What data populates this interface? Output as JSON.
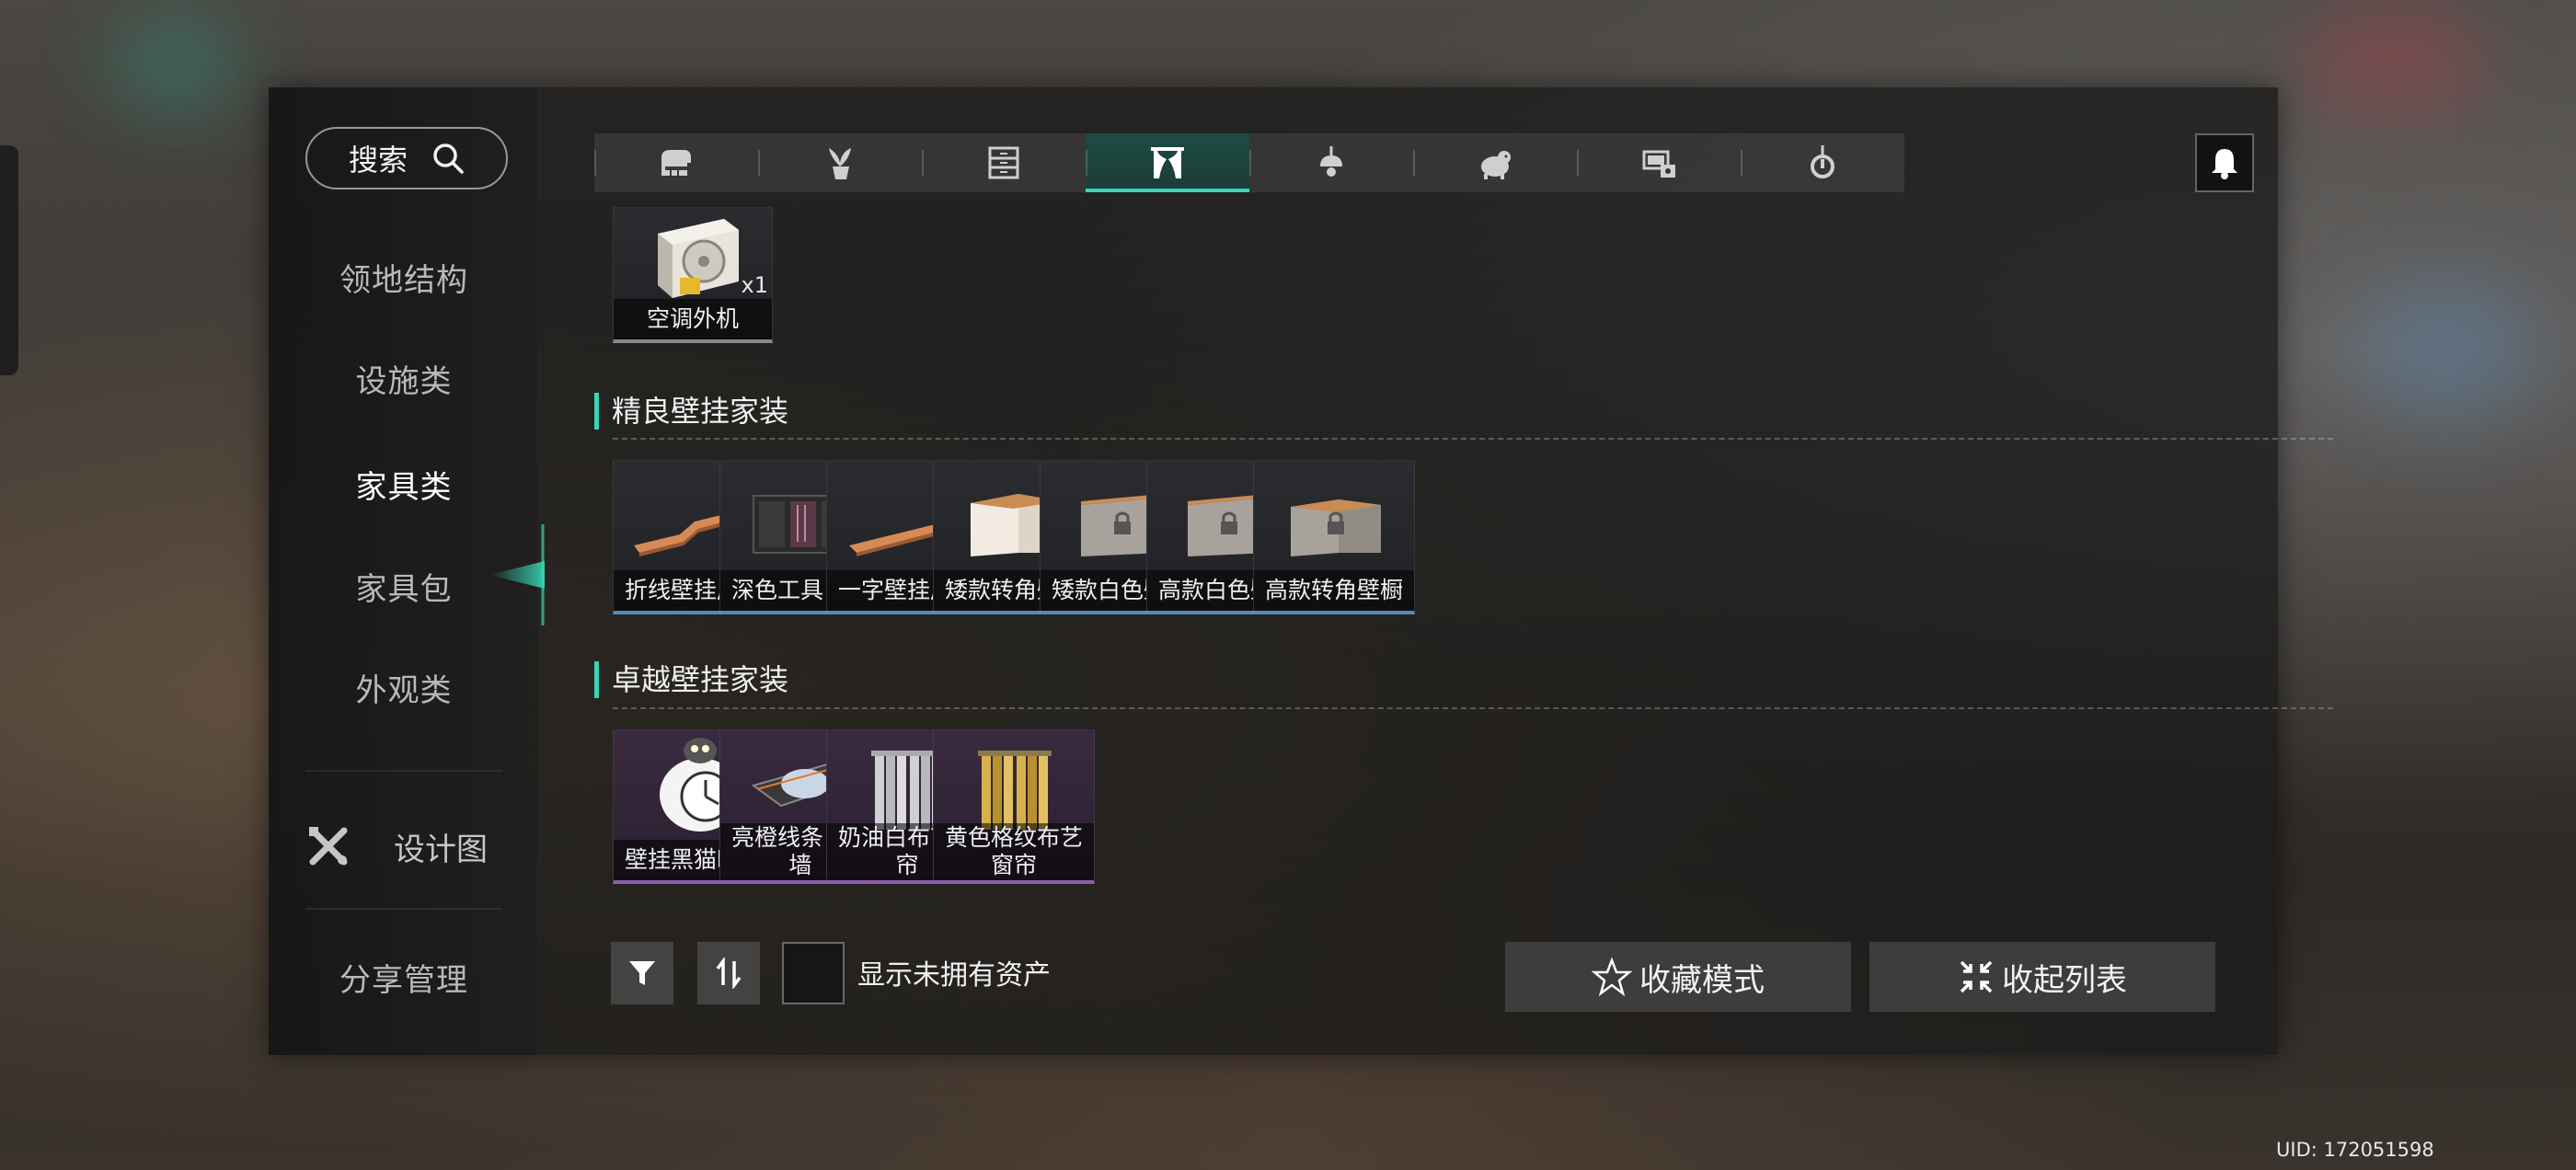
{
  "search": {
    "label": "搜索",
    "icon": "search-icon"
  },
  "sidebar": {
    "items": [
      {
        "label": "领地结构",
        "active": false
      },
      {
        "label": "设施类",
        "active": false
      },
      {
        "label": "家具类",
        "active": true
      },
      {
        "label": "家具包",
        "active": false
      },
      {
        "label": "外观类",
        "active": false
      }
    ],
    "design": {
      "label": "设计图",
      "icon": "design-tools-icon"
    },
    "share": {
      "label": "分享管理"
    }
  },
  "tabs": [
    {
      "icon": "piano-icon",
      "active": false
    },
    {
      "icon": "potted-plant-icon",
      "active": false
    },
    {
      "icon": "drawer-cabinet-icon",
      "active": false
    },
    {
      "icon": "curtain-icon",
      "active": true
    },
    {
      "icon": "ceiling-lamp-icon",
      "active": false
    },
    {
      "icon": "pet-icon",
      "active": false
    },
    {
      "icon": "appliance-icon",
      "active": false
    },
    {
      "icon": "pendant-light-icon",
      "active": false
    }
  ],
  "top_item": {
    "label": "空调外机",
    "count": "x1"
  },
  "sections": [
    {
      "title": "精良壁挂家装",
      "items": [
        "折线壁挂展架",
        "深色工具吊柜",
        "一字壁挂展架",
        "矮款转角壁橱",
        "矮款白色壁橱",
        "高款白色壁橱",
        "高款转角壁橱"
      ]
    },
    {
      "title": "卓越壁挂家装",
      "items": [
        "壁挂黑猫时钟",
        "亮橙线条电视墙",
        "奶油白布艺窗帘",
        "黄色格纹布艺窗帘"
      ]
    }
  ],
  "bottom": {
    "show_unowned": "显示未拥有资产",
    "favorite_mode": "收藏模式",
    "collapse_list": "收起列表"
  },
  "uid": "UID: 172051598",
  "colors": {
    "accent": "#37d6b6",
    "rare_blue": "#5b86b8",
    "epic_purple": "#8c5fb0"
  }
}
